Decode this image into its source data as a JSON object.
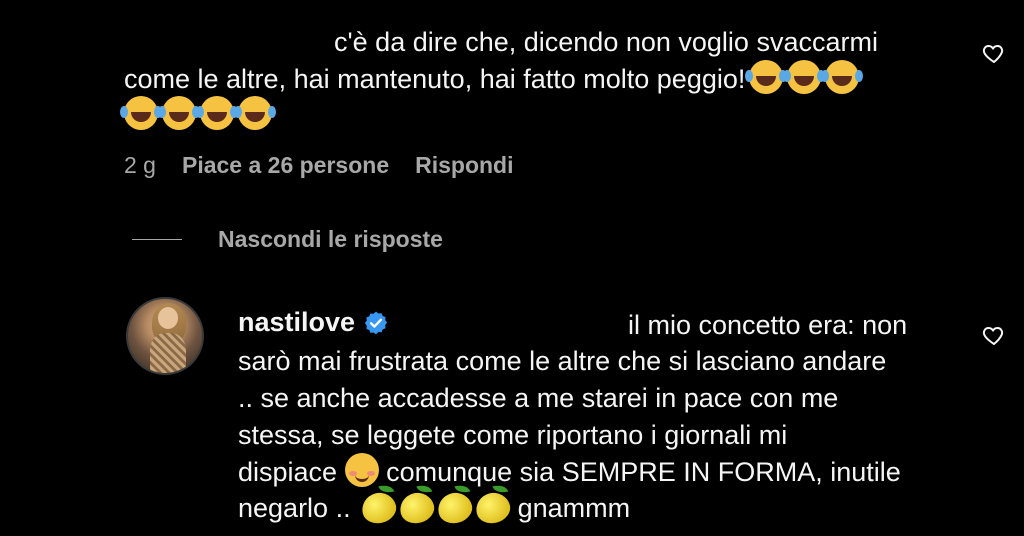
{
  "comment1": {
    "line1": "c'è da dire che, dicendo non voglio svaccarmi",
    "line2": "come le altre, hai mantenuto, hai fatto molto peggio!",
    "emoji_laugh_count_line2": 3,
    "emoji_laugh_count_line3": 4,
    "emoji_icon": "face-with-tears-of-joy-icon",
    "time": "2 g",
    "likes": "Piace a 26 persone",
    "reply": "Rispondi"
  },
  "replies_toggle": {
    "label": "Nascondi le risposte"
  },
  "comment2": {
    "username": "nastilove",
    "line1": "il mio concetto era: non",
    "line2": "sarò mai frustrata come le altre che si lasciano andare",
    "line3": ".. se anche accadesse a me starei in pace con me",
    "line4": "stessa, se leggete come riportano i giornali mi",
    "line5a": "dispiace",
    "line5b": "comunque sia SEMPRE IN FORMA, inutile",
    "line6a": "negarlo ..",
    "line6b": "gnammm",
    "emoji_blush": "smiling-face-icon",
    "emoji_lemon": "lemon-icon",
    "lemon_count": 4
  },
  "colors": {
    "background": "#000000",
    "text": "#f5f5f5",
    "muted": "#a8a8a8",
    "verified": "#3897f0"
  }
}
